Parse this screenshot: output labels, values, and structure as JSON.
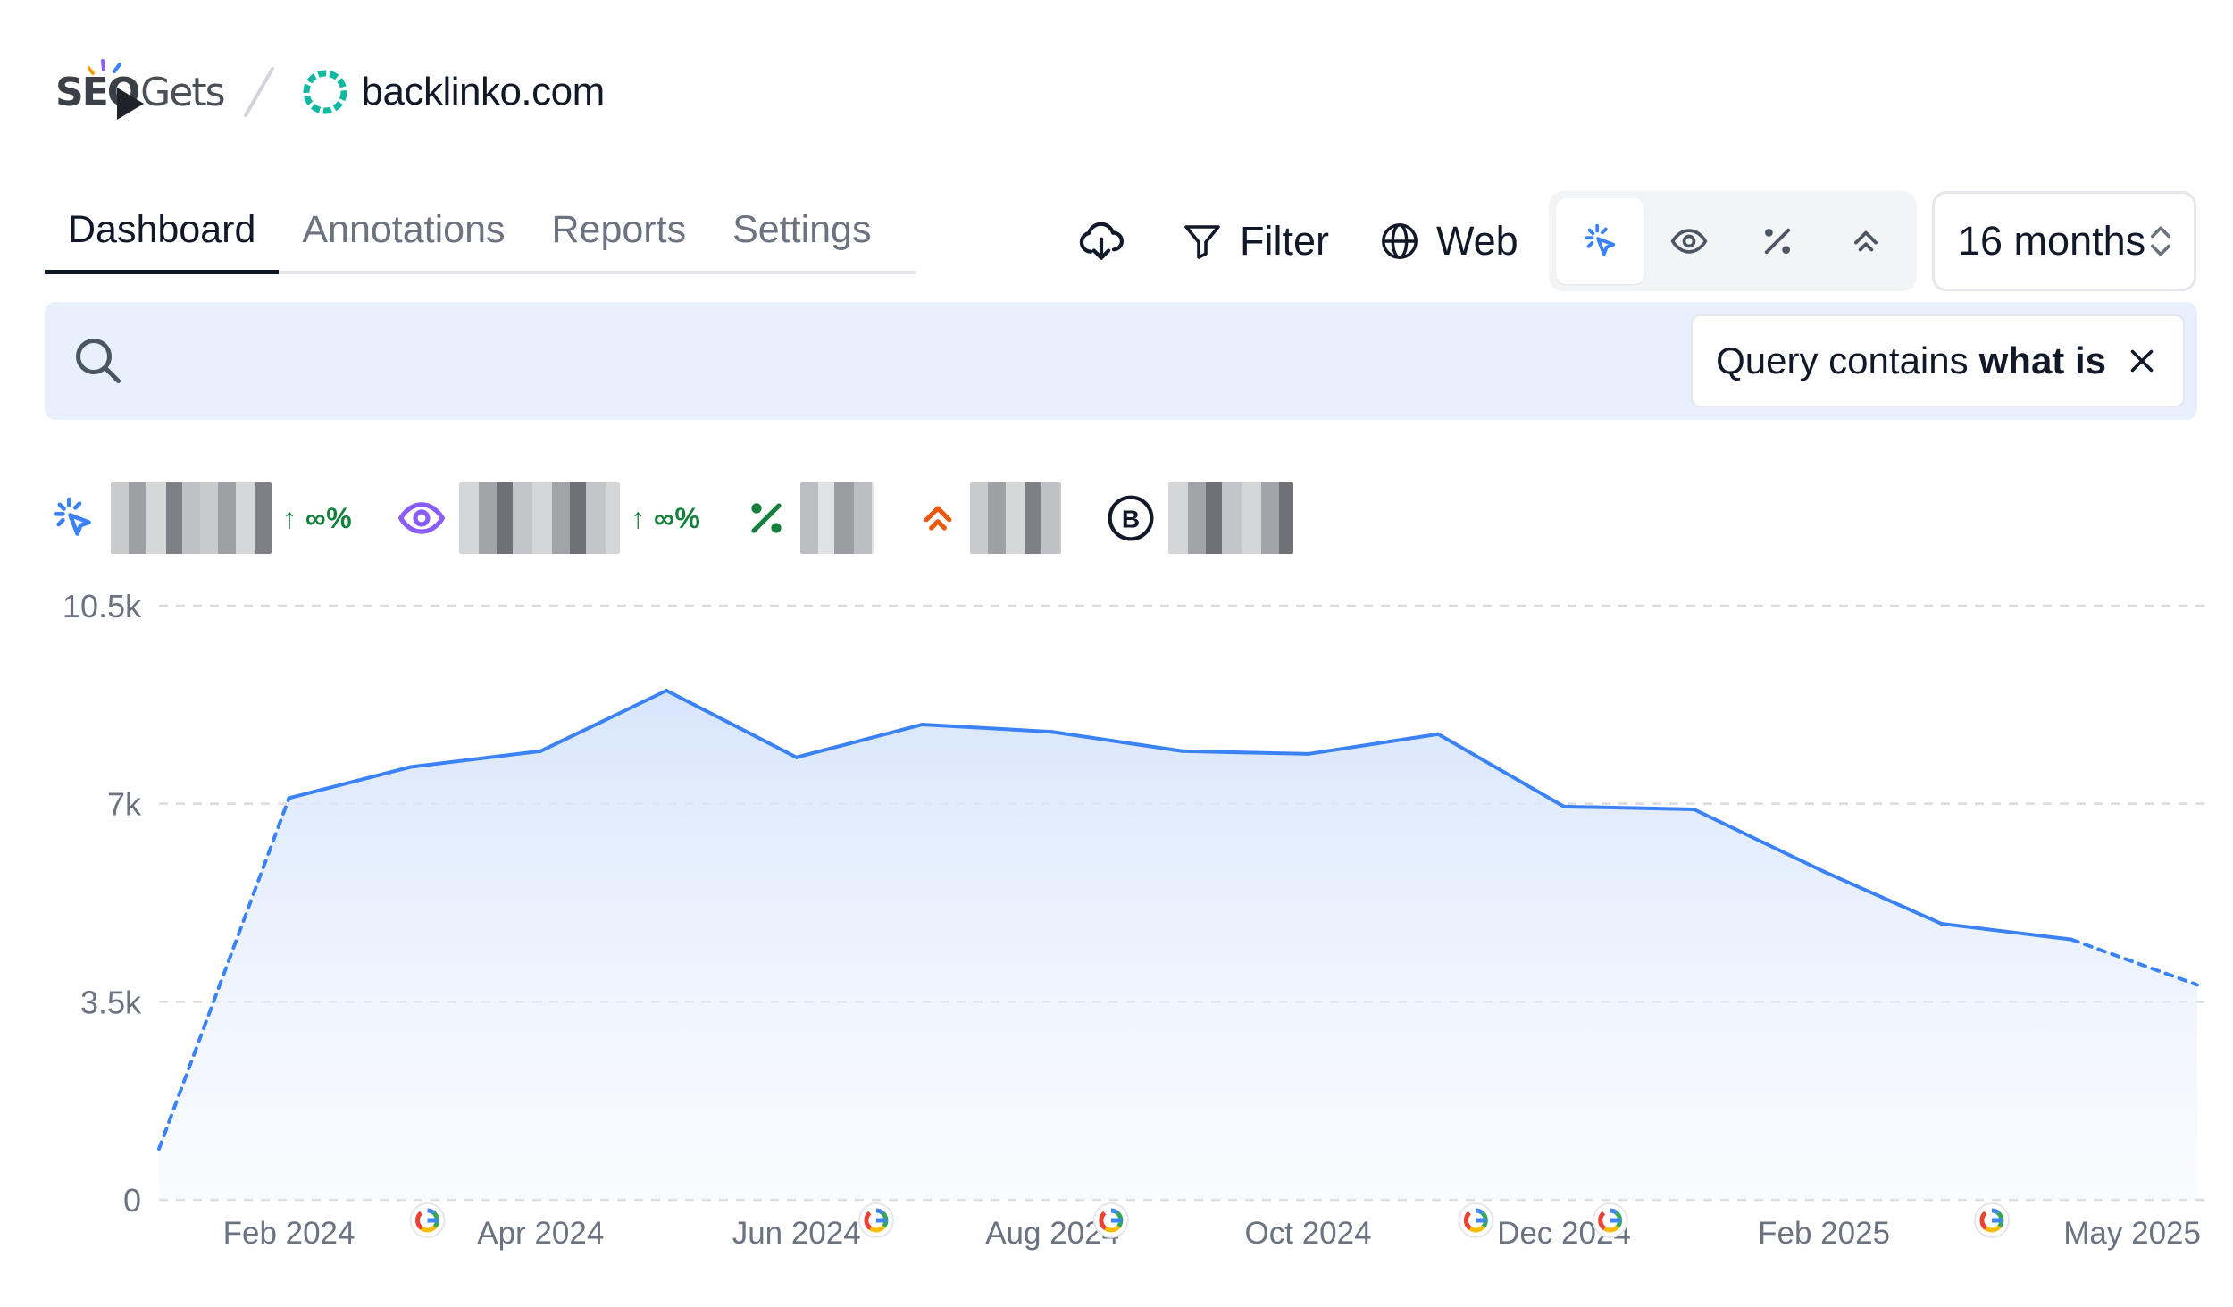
{
  "brand": {
    "logo_text_a": "SEO",
    "logo_text_b": "Gets",
    "site": "backlinko.com"
  },
  "tabs": [
    {
      "label": "Dashboard",
      "active": true
    },
    {
      "label": "Annotations",
      "active": false
    },
    {
      "label": "Reports",
      "active": false
    },
    {
      "label": "Settings",
      "active": false
    }
  ],
  "toolbar": {
    "download_icon": "cloud-download-icon",
    "filter_label": "Filter",
    "web_label": "Web",
    "metric_toggles": [
      "clicks-icon",
      "impressions-icon",
      "ctr-icon",
      "position-icon"
    ],
    "active_toggle": "clicks-icon",
    "range_label": "16 months"
  },
  "search": {
    "placeholder": "",
    "filter_prefix": "Query contains",
    "filter_value": "what is"
  },
  "metrics": [
    {
      "icon": "clicks-icon",
      "value_hidden": true,
      "delta": "↑ ∞%",
      "color": "#3b82f6"
    },
    {
      "icon": "impressions-icon",
      "value_hidden": true,
      "delta": "↑ ∞%",
      "color": "#8b5cf6"
    },
    {
      "icon": "ctr-icon",
      "value_hidden": true,
      "color": "#15803d"
    },
    {
      "icon": "position-icon",
      "value_hidden": true,
      "color": "#ea580c"
    },
    {
      "icon": "branded-icon",
      "value_hidden": true,
      "color": "#111827"
    }
  ],
  "chart_data": {
    "type": "area",
    "series": [
      {
        "values": [
          [
            "2024-01-01",
            900
          ],
          [
            "2024-02-01",
            7100
          ],
          [
            "2024-03-01",
            7650
          ],
          [
            "2024-04-01",
            7930
          ],
          [
            "2024-05-01",
            9000
          ],
          [
            "2024-06-01",
            7820
          ],
          [
            "2024-07-01",
            8400
          ],
          [
            "2024-08-01",
            8270
          ],
          [
            "2024-09-01",
            7930
          ],
          [
            "2024-10-01",
            7880
          ],
          [
            "2024-11-01",
            8230
          ],
          [
            "2024-12-01",
            6950
          ],
          [
            "2025-01-01",
            6900
          ],
          [
            "2025-02-01",
            5800
          ],
          [
            "2025-03-01",
            4880
          ],
          [
            "2025-04-01",
            4600
          ],
          [
            "2025-05-01",
            3800
          ]
        ],
        "dashed_segments": [
          [
            0,
            1
          ],
          [
            15,
            16
          ]
        ],
        "color": "#3b82f6"
      }
    ],
    "y_ticks": [
      "0",
      "3.5k",
      "7k",
      "10.5k"
    ],
    "y_tick_values": [
      0,
      3500,
      7000,
      10500
    ],
    "ylim": [
      0,
      10500
    ],
    "x_ticks": [
      "Feb 2024",
      "Apr 2024",
      "Jun 2024",
      "Aug 2024",
      "Oct 2024",
      "Dec 2024",
      "Feb 2025",
      "May 2025"
    ],
    "x_tick_dates": [
      "2024-02-01",
      "2024-04-01",
      "2024-06-01",
      "2024-08-01",
      "2024-10-01",
      "2024-12-01",
      "2025-02-01",
      "2025-05-01"
    ],
    "google_update_markers": [
      "2024-03-05",
      "2024-06-20",
      "2024-08-15",
      "2024-11-10",
      "2024-12-12",
      "2025-03-13"
    ],
    "grid": true,
    "legend": "none"
  }
}
